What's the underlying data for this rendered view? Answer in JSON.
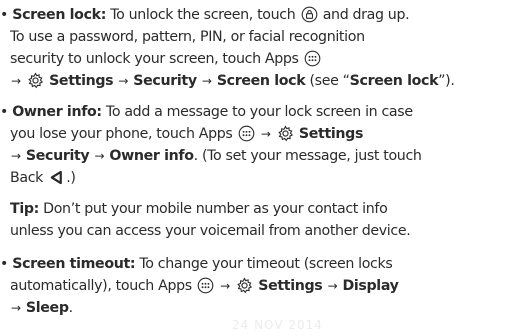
{
  "items": [
    {
      "bullet": "•",
      "title": "Screen lock:",
      "line1": "To unlock the screen, touch",
      "line1b": "and drag up.",
      "line2": "To use a password, pattern, PIN, or facial recognition",
      "line3": "security to unlock your screen, touch Apps",
      "settings": "Settings",
      "security": "Security",
      "screen_lock": "Screen lock",
      "see_prefix": "(see “",
      "see_link": "Screen lock",
      "see_suffix": "”)."
    },
    {
      "bullet": "•",
      "title": "Owner info:",
      "line1": "To add a message to your lock screen in case",
      "line2": "you lose your phone, touch Apps",
      "settings": "Settings",
      "security": "Security",
      "owner_info": "Owner info",
      "line3b": ". (To set your message, just touch",
      "back": "Back",
      "line4b": ".)"
    },
    {
      "tip_label": "Tip:",
      "tip_line1": "Don’t put your mobile number as your contact info",
      "tip_line2": "unless you can access your voicemail from another device."
    },
    {
      "bullet": "•",
      "title": "Screen timeout:",
      "line1": "To change your timeout (screen locks",
      "line2": "automatically), touch Apps",
      "settings": "Settings",
      "display": "Display",
      "sleep": "Sleep",
      "line3b": "."
    }
  ],
  "arrow": "→",
  "watermark": "24 NOV 2014",
  "icons": [
    "lock-icon",
    "apps-icon",
    "gear-icon",
    "back-icon"
  ]
}
